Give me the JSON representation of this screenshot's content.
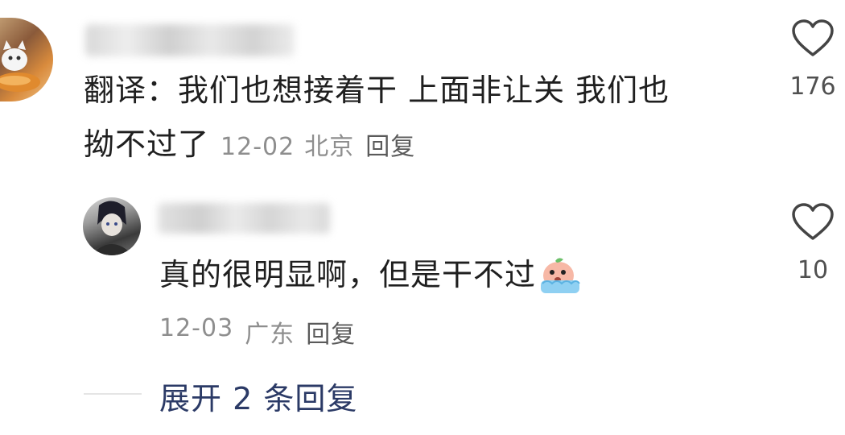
{
  "comment": {
    "text_line1": "翻译：我们也想接着干 上面非让关 我们也",
    "text_line2": "拗不过了",
    "date": "12-02",
    "location": "北京",
    "reply_label": "回复",
    "like_count": "176"
  },
  "reply": {
    "text": "真的很明显啊，但是干不过",
    "emoji": "crying-face-emoji",
    "date": "12-03",
    "location": "广东",
    "reply_label": "回复",
    "like_count": "10"
  },
  "expand_replies": {
    "label": "展开 2 条回复"
  },
  "colors": {
    "expand_link": "#2b3a66",
    "meta_text": "#8e8e8e",
    "heart_outline": "#444444"
  }
}
